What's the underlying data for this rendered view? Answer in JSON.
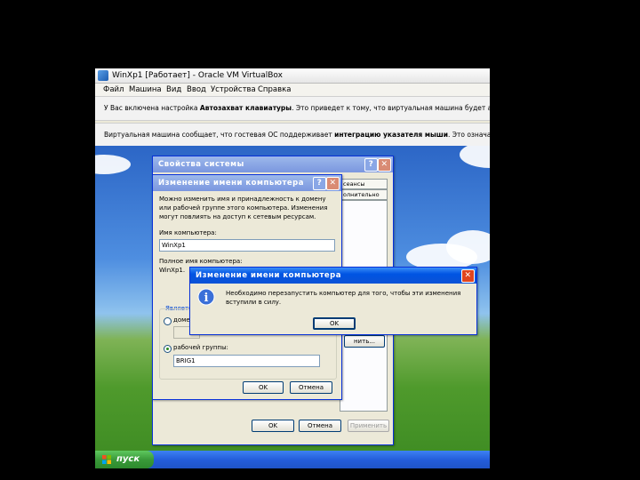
{
  "vbox": {
    "title": "WinXp1 [Работает] - Oracle VM VirtualBox",
    "menu": [
      "Файл",
      "Машина",
      "Вид",
      "Ввод",
      "Устройства",
      "Справка"
    ],
    "notice1_pre": "У Вас включена настройка ",
    "notice1_bold": "Автозахват клавиатуры",
    "notice1_post": ". Это приведет к тому, что виртуальная машина будет автоматически за",
    "notice2_pre": "Виртуальная машина сообщает, что гостевая ОС поддерживает ",
    "notice2_bold": "интеграцию указателя мыши",
    "notice2_post": ". Это означает, что не требуе"
  },
  "sysprops": {
    "title": "Свойства системы",
    "tab_sessions": "сеансы",
    "tab_advanced": "олнительно",
    "change_btn": "нить...",
    "ok": "OK",
    "cancel": "Отмена",
    "apply": "Применить"
  },
  "rename": {
    "title": "Изменение имени компьютера",
    "description": "Можно изменить имя и принадлежность к домену или рабочей группе этого компьютера. Изменения могут повлиять на доступ к сетевым ресурсам.",
    "computer_name_label": "Имя компьютера:",
    "computer_name_value": "WinXp1",
    "full_name_label": "Полное имя компьютера:",
    "full_name_value": "WinXp1.",
    "member_of_label": "Являетс",
    "domain_label": "доме",
    "workgroup_label": "рабочей группы:",
    "workgroup_value": "BRIG1",
    "ok": "OK",
    "cancel": "Отмена"
  },
  "alert": {
    "title": "Изменение имени компьютера",
    "message": "Необходимо перезапустить компьютер для того, чтобы эти изменения вступили в силу.",
    "ok": "OK"
  },
  "taskbar": {
    "start_label": "пуск"
  }
}
